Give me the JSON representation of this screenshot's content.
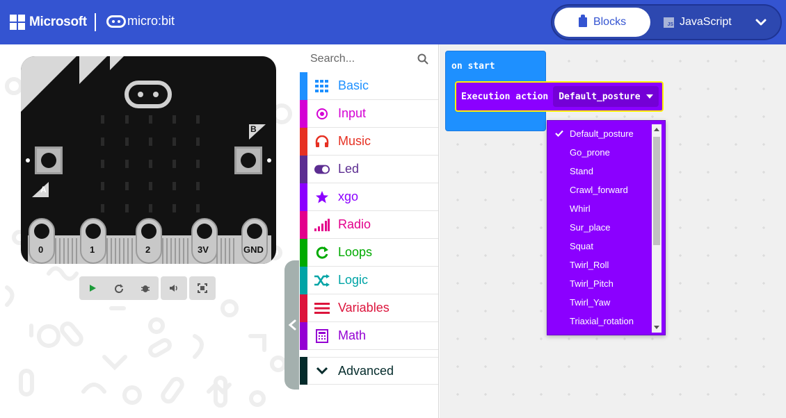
{
  "header": {
    "microsoft_label": "Microsoft",
    "microbit_label": "micro:bit",
    "blocks_label": "Blocks",
    "javascript_label": "JavaScript",
    "js_icon_text": "JS",
    "brand_color": "#3454d1"
  },
  "board": {
    "button_a": "A",
    "button_b": "B",
    "pins": [
      "0",
      "1",
      "2",
      "3V",
      "GND"
    ]
  },
  "toolbox": {
    "search_placeholder": "Search...",
    "categories": [
      {
        "label": "Basic",
        "color": "#1e90ff",
        "icon": "grid-icon"
      },
      {
        "label": "Input",
        "color": "#d400d4",
        "icon": "radio-circle-icon"
      },
      {
        "label": "Music",
        "color": "#e63022",
        "icon": "headphones-icon"
      },
      {
        "label": "Led",
        "color": "#5c2d91",
        "icon": "toggle-icon"
      },
      {
        "label": "xgo",
        "color": "#8b00ff",
        "icon": "star-icon"
      },
      {
        "label": "Radio",
        "color": "#e3008c",
        "icon": "signal-bars-icon"
      },
      {
        "label": "Loops",
        "color": "#00aa00",
        "icon": "refresh-icon"
      },
      {
        "label": "Logic",
        "color": "#00a4a6",
        "icon": "shuffle-icon"
      },
      {
        "label": "Variables",
        "color": "#dc143c",
        "icon": "lines-icon"
      },
      {
        "label": "Math",
        "color": "#9400d3",
        "icon": "calculator-icon"
      }
    ],
    "advanced_label": "Advanced",
    "advanced_color": "#042b2b"
  },
  "workspace": {
    "on_start_label": "on start",
    "exec_label": "Execution action",
    "exec_value": "Default_posture"
  },
  "dropdown": {
    "selected": "Default_posture",
    "options": [
      "Default_posture",
      "Go_prone",
      "Stand",
      "Crawl_forward",
      "Whirl",
      "Sur_place",
      "Squat",
      "Twirl_Roll",
      "Twirl_Pitch",
      "Twirl_Yaw",
      "Triaxial_rotation"
    ]
  }
}
